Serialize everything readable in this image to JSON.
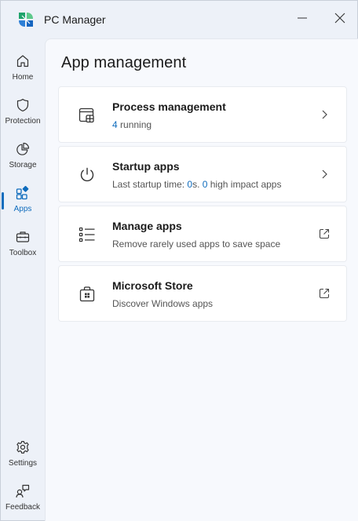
{
  "window": {
    "title": "PC Manager",
    "minimize_icon": "minimize-icon",
    "close_icon": "close-icon"
  },
  "sidebar": {
    "items": [
      {
        "label": "Home",
        "icon": "home-icon",
        "active": false
      },
      {
        "label": "Protection",
        "icon": "shield-icon",
        "active": false
      },
      {
        "label": "Storage",
        "icon": "pie-chart-icon",
        "active": false
      },
      {
        "label": "Apps",
        "icon": "apps-icon",
        "active": true
      },
      {
        "label": "Toolbox",
        "icon": "toolbox-icon",
        "active": false
      }
    ],
    "bottom_items": [
      {
        "label": "Settings",
        "icon": "gear-icon"
      },
      {
        "label": "Feedback",
        "icon": "feedback-icon"
      }
    ]
  },
  "main": {
    "title": "App management",
    "cards": [
      {
        "title": "Process management",
        "sub_count": "4",
        "sub_text": " running",
        "icon": "process-window-icon",
        "trail": "chevron-right-icon"
      },
      {
        "title": "Startup apps",
        "sub_prefix": "Last startup time: ",
        "sub_time": "0",
        "sub_mid1": "s. ",
        "sub_impact": "0",
        "sub_suffix": " high impact apps",
        "icon": "power-icon",
        "trail": "chevron-right-icon"
      },
      {
        "title": "Manage apps",
        "sub": "Remove rarely used apps to save space",
        "icon": "list-icon",
        "trail": "external-link-icon"
      },
      {
        "title": "Microsoft Store",
        "sub": "Discover Windows apps",
        "icon": "store-bag-icon",
        "trail": "external-link-icon"
      }
    ]
  },
  "colors": {
    "accent": "#0f6cbd",
    "window_bg": "#edf1f8",
    "panel_bg": "#f7f9fd",
    "card_bg": "#ffffff"
  }
}
